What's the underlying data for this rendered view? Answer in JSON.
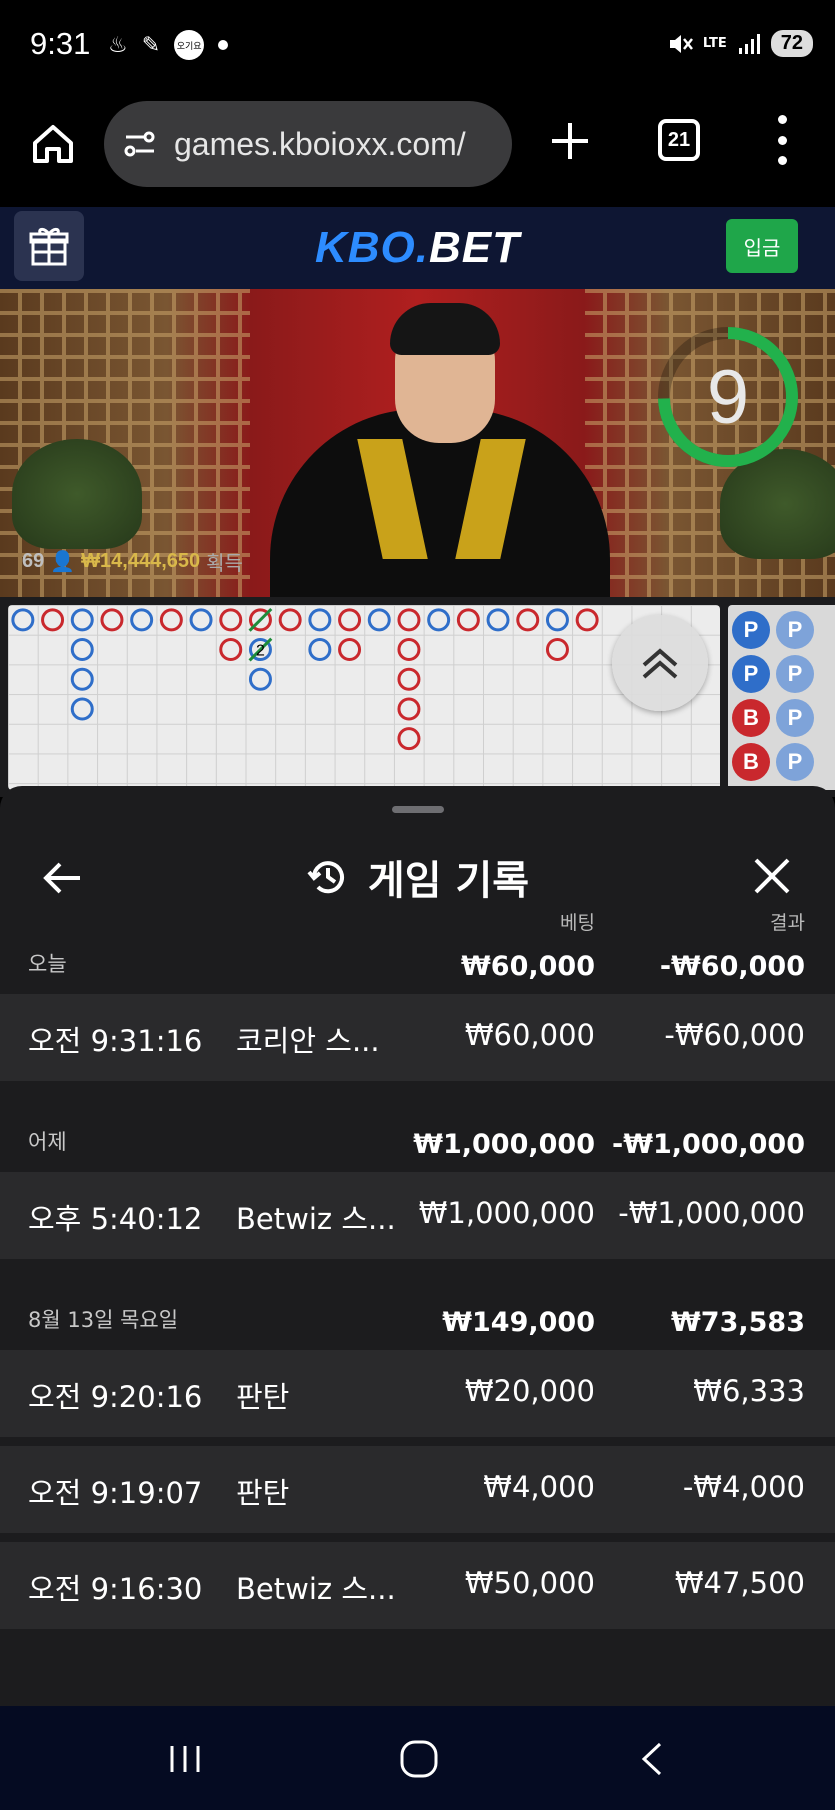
{
  "status_bar": {
    "time": "9:31",
    "notif_badge": "오기요",
    "network": "LTE",
    "battery": "72",
    "icons": [
      "fire-icon",
      "crown-icon",
      "app-badge-icon",
      "dot-icon",
      "mute-icon",
      "lte-icon",
      "signal-icon",
      "battery-icon"
    ]
  },
  "browser": {
    "url": "games.kboioxx.com/",
    "tab_count": "21"
  },
  "site_header": {
    "logo_kbo": "KBO.",
    "logo_bet": "BET",
    "deposit_label": "입금"
  },
  "live": {
    "timer_value": "9",
    "player_count": "69",
    "win_amount": "₩14,444,650",
    "win_label": "획득"
  },
  "road": {
    "prediction_labels": [
      "P",
      "P",
      "P",
      "P",
      "B",
      "P",
      "B",
      "P"
    ],
    "tie_count": "2"
  },
  "sheet": {
    "title": "게임 기록",
    "col_bet": "베팅",
    "col_result": "결과",
    "groups": [
      {
        "label": "오늘",
        "bet_total": "₩60,000",
        "result_total": "-₩60,000",
        "records": [
          {
            "time": "오전 9:31:16",
            "game": "코리안 스...",
            "bet": "₩60,000",
            "result": "-₩60,000"
          }
        ]
      },
      {
        "label": "어제",
        "bet_total": "₩1,000,000",
        "result_total": "-₩1,000,000",
        "records": [
          {
            "time": "오후 5:40:12",
            "game": "Betwiz 스...",
            "bet": "₩1,000,000",
            "result": "-₩1,000,000"
          }
        ]
      },
      {
        "label": "8월 13일 목요일",
        "bet_total": "₩149,000",
        "result_total": "₩73,583",
        "records": [
          {
            "time": "오전 9:20:16",
            "game": "판탄",
            "bet": "₩20,000",
            "result": "₩6,333"
          },
          {
            "time": "오전 9:19:07",
            "game": "판탄",
            "bet": "₩4,000",
            "result": "-₩4,000"
          },
          {
            "time": "오전 9:16:30",
            "game": "Betwiz 스...",
            "bet": "₩50,000",
            "result": "₩47,500"
          }
        ]
      }
    ]
  },
  "colors": {
    "accent_blue": "#2d8cff",
    "deposit_green": "#1fa64a",
    "banker_red": "#c9282d",
    "player_blue": "#2f6ec9",
    "timer_green": "#22b14c"
  }
}
